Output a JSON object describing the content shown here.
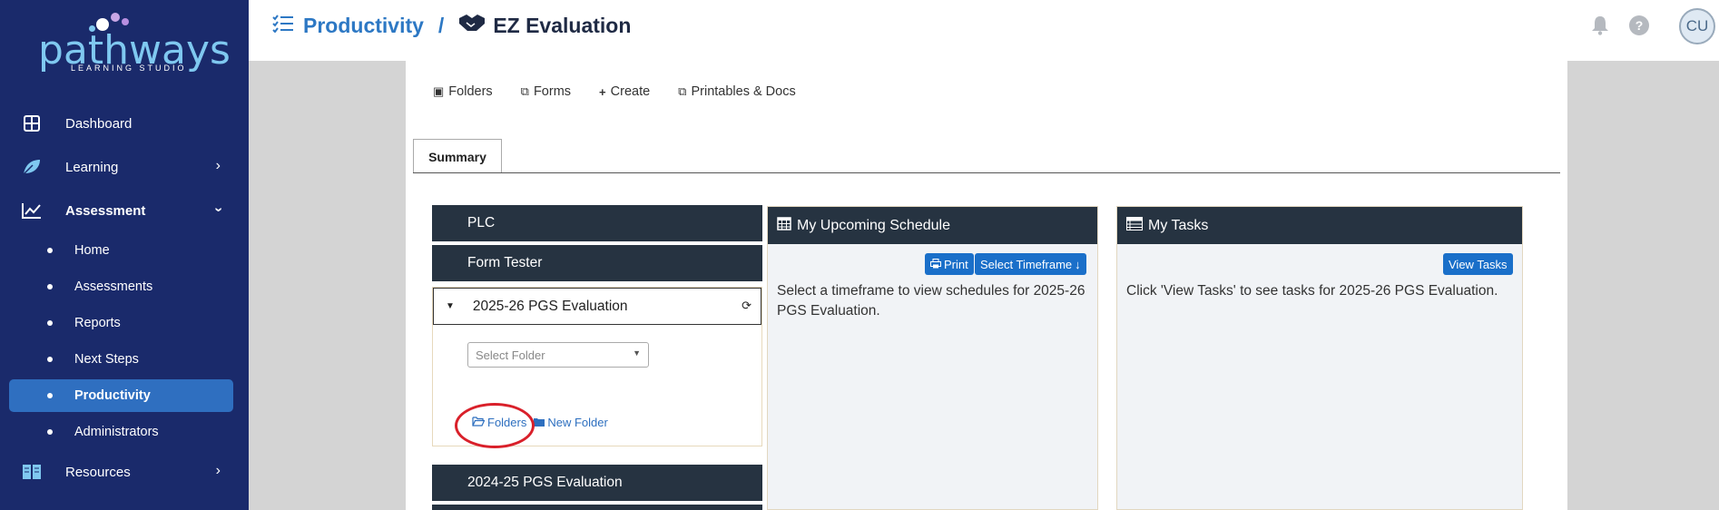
{
  "sidebar": {
    "logo_text": "pathways",
    "logo_sub": "LEARNING STUDIO",
    "items": [
      {
        "label": "Dashboard"
      },
      {
        "label": "Learning"
      },
      {
        "label": "Assessment"
      },
      {
        "label": "Resources"
      }
    ],
    "sub_items": [
      {
        "label": "Home"
      },
      {
        "label": "Assessments"
      },
      {
        "label": "Reports"
      },
      {
        "label": "Next Steps"
      },
      {
        "label": "Productivity"
      },
      {
        "label": "Administrators"
      }
    ]
  },
  "header": {
    "crumb_parent": "Productivity",
    "crumb_sep": "/",
    "crumb_current": "EZ Evaluation",
    "avatar": "CU"
  },
  "toolbar": {
    "folders": "Folders",
    "forms": "Forms",
    "create": "Create",
    "printables": "Printables & Docs"
  },
  "tab": {
    "summary": "Summary"
  },
  "folders": {
    "plc": "PLC",
    "form_tester": "Form Tester",
    "eval_current": "2025-26 PGS Evaluation",
    "select_placeholder": "Select Folder",
    "folders_link": "Folders",
    "new_folder_link": "New Folder",
    "eval_prev": "2024-25 PGS Evaluation"
  },
  "schedule": {
    "title": "My Upcoming Schedule",
    "print": "Print",
    "select_timeframe": "Select Timeframe",
    "text": "Select a timeframe to view schedules for 2025-26 PGS Evaluation."
  },
  "tasks": {
    "title": "My Tasks",
    "view_tasks": "View Tasks",
    "text": "Click 'View Tasks' to see tasks for 2025-26 PGS Evaluation."
  },
  "colors": {
    "sidebar": "#1a2a6b",
    "active": "#2f6fc0",
    "dark_bar": "#263341",
    "button": "#1a6fc9",
    "highlight_circle": "#d9202a"
  }
}
